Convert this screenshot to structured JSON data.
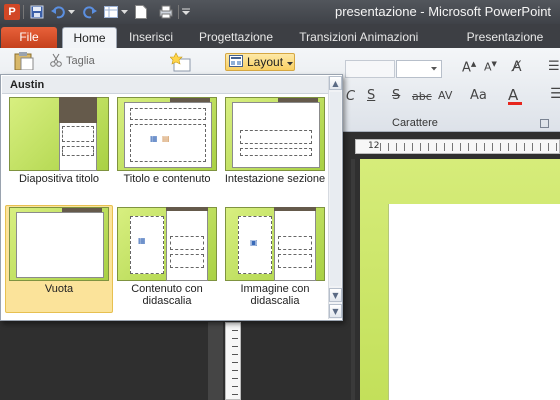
{
  "window": {
    "title": "presentazione - Microsoft PowerPoint",
    "app_logo_letter": "P"
  },
  "tabs": [
    {
      "id": "file",
      "label": "File"
    },
    {
      "id": "home",
      "label": "Home"
    },
    {
      "id": "insert",
      "label": "Inserisci"
    },
    {
      "id": "design",
      "label": "Progettazione"
    },
    {
      "id": "transitions",
      "label": "Transizioni"
    },
    {
      "id": "animations",
      "label": "Animazioni"
    },
    {
      "id": "slideshow",
      "label": "Presentazione"
    }
  ],
  "ribbon": {
    "cut_label": "Taglia",
    "layout_label": "Layout",
    "font_group_label": "Carattere"
  },
  "ruler": {
    "top_label": "12"
  },
  "layout_menu": {
    "theme_header": "Austin",
    "items": [
      {
        "label": "Diapositiva titolo",
        "selected": false
      },
      {
        "label": "Titolo e contenuto",
        "selected": false
      },
      {
        "label": "Intestazione sezione",
        "selected": false
      },
      {
        "label": "Vuota",
        "selected": true
      },
      {
        "label": "Contenuto con didascalia",
        "selected": false
      },
      {
        "label": "Immagine con didascalia",
        "selected": false
      }
    ]
  },
  "colors": {
    "file_tab": "#d24726",
    "selected_item": "#fbe39a",
    "slide_green": "#c3e05a",
    "layout_button": "#f8cf63"
  },
  "icons": {
    "save": "save-icon",
    "undo": "undo-icon",
    "redo": "redo-icon",
    "new": "new-document-icon",
    "print": "print-icon",
    "cut": "scissors-icon"
  }
}
